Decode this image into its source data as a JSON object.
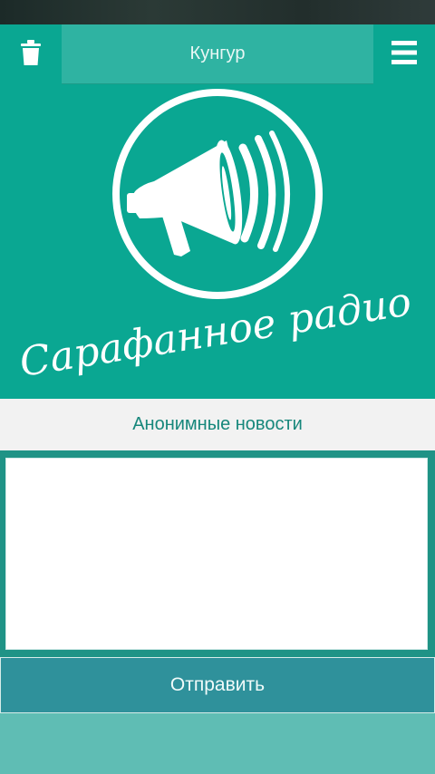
{
  "header": {
    "title": "Кунгур",
    "left_icon": "trash-icon",
    "right_icon": "menu-icon"
  },
  "banner": {
    "logo_icon": "megaphone-icon",
    "logo_text": "Сарафанное радио"
  },
  "section": {
    "title": "Анонимные новости"
  },
  "form": {
    "textarea_value": "",
    "submit_label": "Отправить"
  },
  "colors": {
    "primary": "#0aa792",
    "title_box": "#2fb3a2",
    "button": "#2f919b",
    "section_text": "#16877b",
    "bottom": "#5fbdb4"
  }
}
